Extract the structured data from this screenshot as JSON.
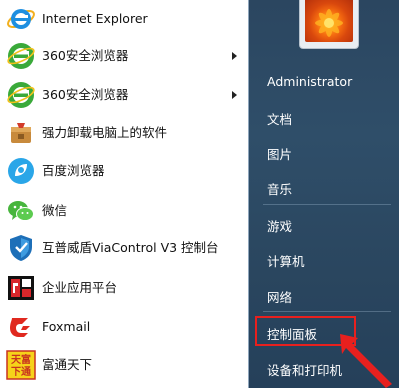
{
  "programs": [
    {
      "label": "Internet Explorer",
      "icon": "internet-explorer-icon",
      "submenu": false
    },
    {
      "label": "360安全浏览器",
      "icon": "360-browser-icon",
      "submenu": true
    },
    {
      "label": "360安全浏览器",
      "icon": "360-browser-icon",
      "submenu": true
    },
    {
      "label": "强力卸载电脑上的软件",
      "icon": "uninstaller-icon",
      "submenu": false
    },
    {
      "label": "百度浏览器",
      "icon": "baidu-browser-icon",
      "submenu": false
    },
    {
      "label": "微信",
      "icon": "wechat-icon",
      "submenu": false
    },
    {
      "label": "互普威盾ViaControl V3 控制台",
      "icon": "shield-icon",
      "submenu": false
    },
    {
      "label": "企业应用平台",
      "icon": "enterprise-app-icon",
      "submenu": false
    },
    {
      "label": "Foxmail",
      "icon": "foxmail-icon",
      "submenu": false
    },
    {
      "label": "富通天下",
      "icon": "futong-icon",
      "submenu": false
    }
  ],
  "right_pane": {
    "user": "Administrator",
    "documents": "文档",
    "pictures": "图片",
    "music": "音乐",
    "games": "游戏",
    "computer": "计算机",
    "network": "网络",
    "control_panel": "控制面板",
    "devices_printers": "设备和打印机"
  },
  "colors": {
    "right_pane_bg": "#2f4e69",
    "highlight_border": "#e8201e"
  }
}
